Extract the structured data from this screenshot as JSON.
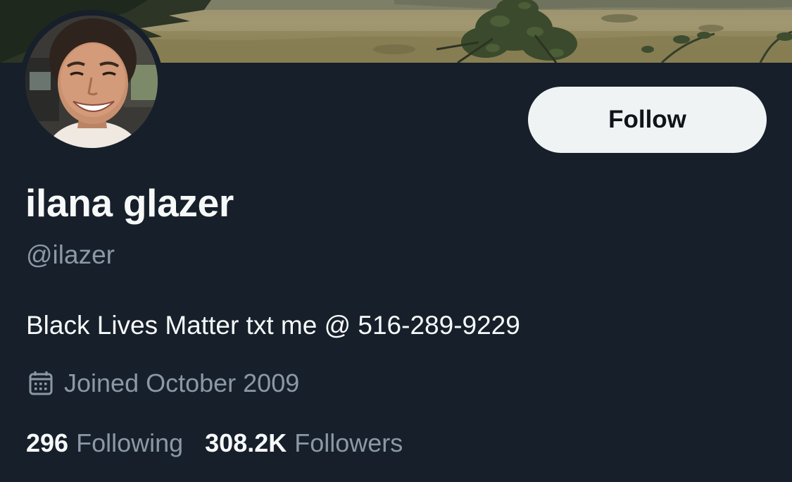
{
  "profile": {
    "display_name": "ilana glazer",
    "handle": "@ilazer",
    "bio": "Black Lives Matter txt me @ 516-289-9229",
    "joined": "Joined October 2009",
    "follow_label": "Follow",
    "following_count": "296",
    "following_label": "Following",
    "followers_count": "308.2K",
    "followers_label": "Followers"
  },
  "icons": {
    "joined": "calendar-icon"
  },
  "colors": {
    "background": "#161f2a",
    "primary_text": "#f7f9f9",
    "secondary_text": "#8b98a5",
    "follow_button_bg": "#eff3f4",
    "follow_button_text": "#0f1419"
  }
}
